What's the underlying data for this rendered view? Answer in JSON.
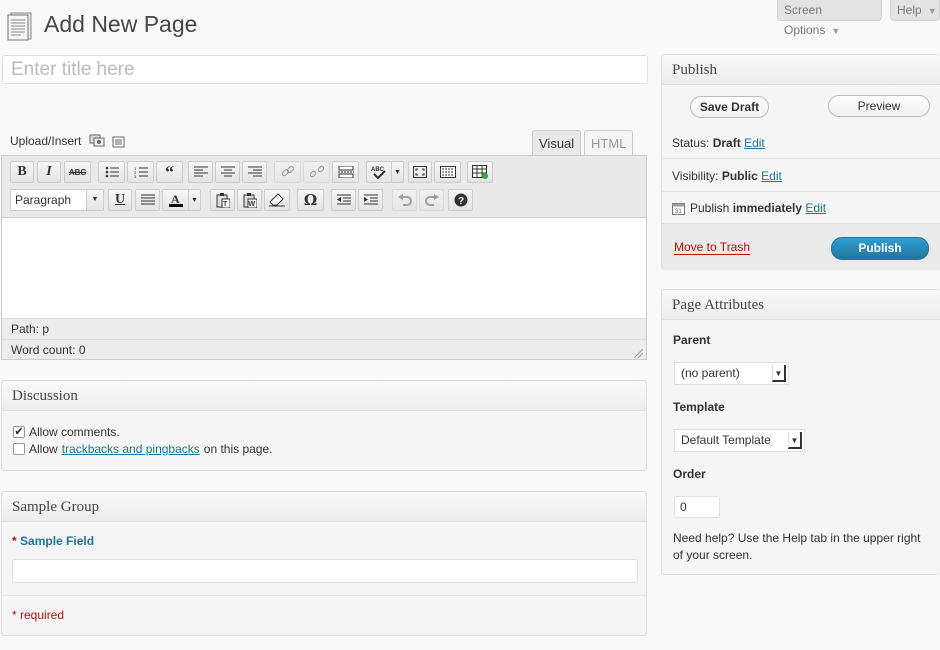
{
  "header": {
    "title": "Add New Page",
    "screen_options": "Screen Options",
    "help": "Help"
  },
  "title_field": {
    "placeholder": "Enter title here",
    "value": ""
  },
  "editor": {
    "upload_insert": "Upload/Insert",
    "tab_visual": "Visual",
    "tab_html": "HTML",
    "format_select": "Paragraph",
    "path_label": "Path:",
    "path_value": "p",
    "word_count_label": "Word count:",
    "word_count_value": "0",
    "toolbar1": [
      "bold-icon",
      "italic-icon",
      "strikethrough-icon",
      "unordered-list-icon",
      "ordered-list-icon",
      "blockquote-icon",
      "align-left-icon",
      "align-center-icon",
      "align-right-icon",
      "link-icon",
      "unlink-icon",
      "more-tag-icon",
      "spellcheck-icon",
      "fullscreen-icon",
      "kitchen-sink-icon",
      "insert-table-icon"
    ],
    "toolbar2": [
      "underline-icon",
      "justify-icon",
      "text-color-icon",
      "paste-text-icon",
      "paste-word-icon",
      "remove-format-icon",
      "omega-icon",
      "outdent-icon",
      "indent-icon",
      "undo-icon",
      "redo-icon",
      "help-icon"
    ]
  },
  "discussion": {
    "title": "Discussion",
    "allow_comments": "Allow comments.",
    "allow_comments_checked": true,
    "allow_prefix": "Allow",
    "trackbacks_link": "trackbacks and pingbacks",
    "trackbacks_suffix": "on this page.",
    "allow_trackbacks_checked": false
  },
  "sample_group": {
    "title": "Sample Group",
    "asterisk": "*",
    "field_label": "Sample Field",
    "required_note": "* required",
    "field_value": ""
  },
  "publish": {
    "title": "Publish",
    "save_draft": "Save Draft",
    "preview": "Preview",
    "status_label": "Status:",
    "status_value": "Draft",
    "visibility_label": "Visibility:",
    "visibility_value": "Public",
    "publish_label": "Publish",
    "publish_value": "immediately",
    "edit": "Edit",
    "move_to_trash": "Move to Trash",
    "publish_button": "Publish"
  },
  "page_attributes": {
    "title": "Page Attributes",
    "parent_label": "Parent",
    "parent_value": "(no parent)",
    "template_label": "Template",
    "template_value": "Default Template",
    "order_label": "Order",
    "order_value": "0",
    "help_text": "Need help? Use the Help tab in the upper right of your screen."
  },
  "colors": {
    "link": "#21759b",
    "trash": "#bc0b0b",
    "publish_button": "#21759b"
  }
}
